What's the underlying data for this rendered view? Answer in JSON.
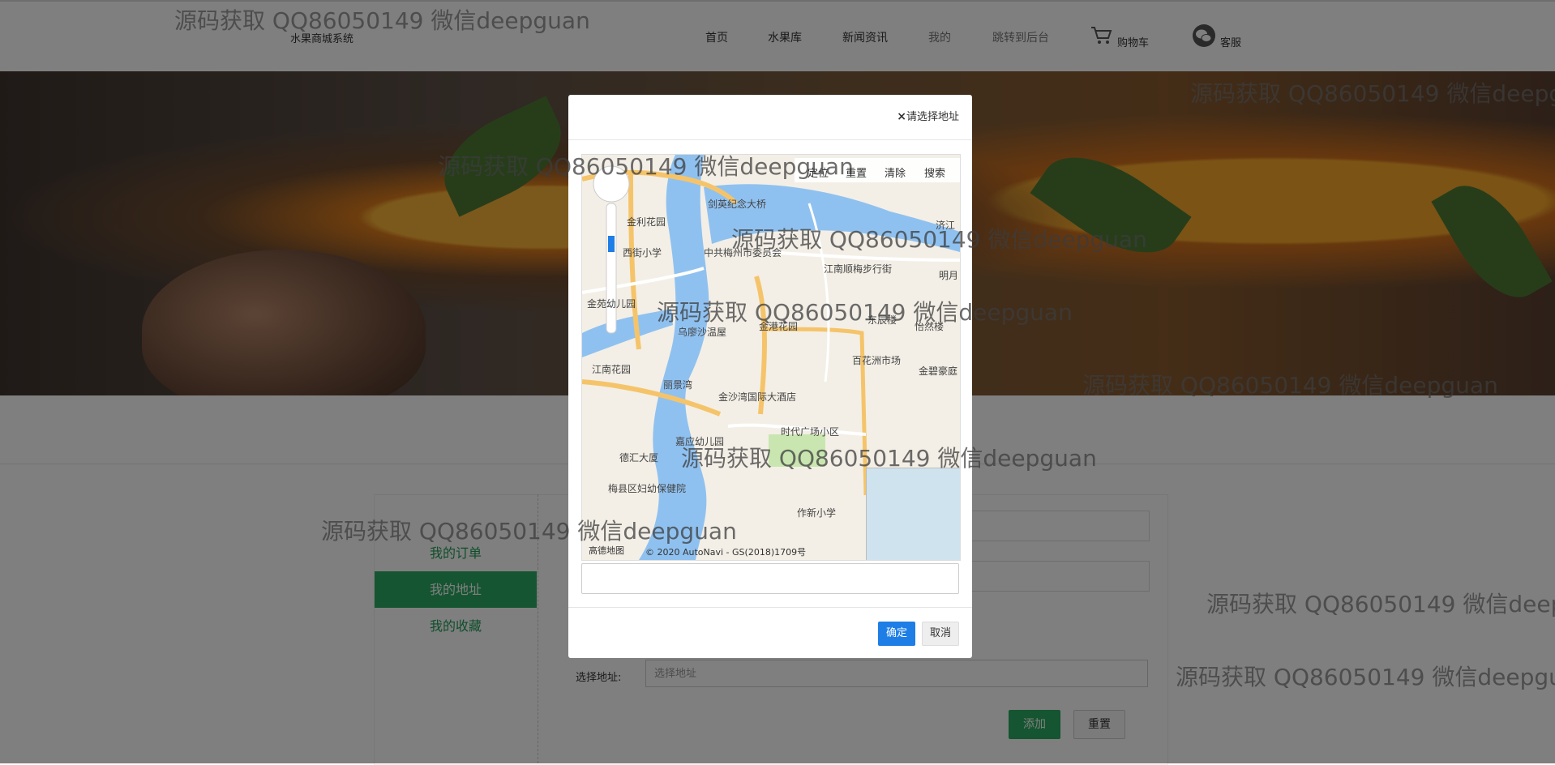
{
  "header": {
    "brand": "水果商城系统",
    "nav": [
      {
        "label": "首页"
      },
      {
        "label": "水果库"
      },
      {
        "label": "新闻资讯"
      },
      {
        "label": "我的"
      },
      {
        "label": "跳转到后台"
      }
    ],
    "cart_label": "购物车",
    "service_label": "客服"
  },
  "sidebar": {
    "items": [
      {
        "label": "我的订单"
      },
      {
        "label": "我的地址"
      },
      {
        "label": "我的收藏"
      }
    ]
  },
  "form": {
    "address_label": "选择地址:",
    "address_placeholder": "选择地址",
    "add_button": "添加",
    "reset_button": "重置"
  },
  "modal": {
    "title": "请选择地址",
    "close_icon": "close-icon",
    "toolbar": [
      "定位",
      "重置",
      "清除",
      "搜索"
    ],
    "map_labels": [
      "金利花园",
      "剑英纪念大桥",
      "西街小学",
      "中共梅州市委员会",
      "江南顺梅步行街",
      "金苑幼儿园",
      "乌廖沙温屋",
      "金港花园",
      "东辰楼",
      "怡然楼",
      "江南花园",
      "丽景湾",
      "百花洲市场",
      "金碧豪庭",
      "金沙湾国际大酒店",
      "时代广场小区",
      "嘉应幼儿园",
      "德汇大厦",
      "梅县区妇幼保健院",
      "作新小学",
      "明月",
      "济江"
    ],
    "map_copyright": "© 2020 AutoNavi - GS(2018)1709号",
    "map_logo": "高德地图",
    "confirm_button": "确定",
    "cancel_button": "取消"
  },
  "watermark": "源码获取 QQ86050149 微信deepguan"
}
